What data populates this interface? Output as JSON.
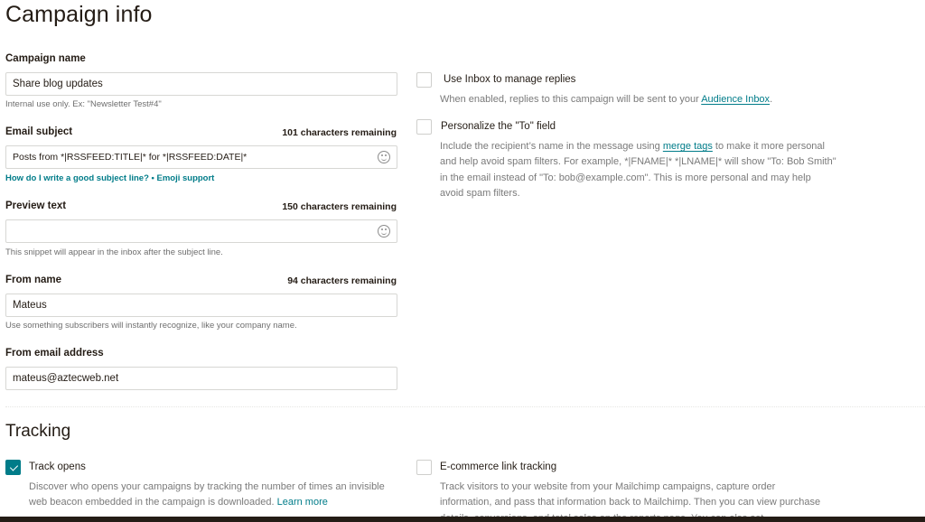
{
  "campaign_info": {
    "title": "Campaign info",
    "campaign_name": {
      "label": "Campaign name",
      "value": "Share blog updates",
      "help": "Internal use only. Ex: \"Newsletter Test#4\""
    },
    "email_subject": {
      "label": "Email subject",
      "remaining": "101 characters remaining",
      "value": "Posts from *|RSSFEED:TITLE|* for *|RSSFEED:DATE|*",
      "link_subject_help": "How do I write a good subject line?",
      "separator": "•",
      "link_emoji": "Emoji support",
      "icon": "emoji-smiley-icon"
    },
    "preview_text": {
      "label": "Preview text",
      "remaining": "150 characters remaining",
      "value": "",
      "help": "This snippet will appear in the inbox after the subject line.",
      "icon": "emoji-smiley-icon"
    },
    "from_name": {
      "label": "From name",
      "remaining": "94 characters remaining",
      "value": "Mateus",
      "help": "Use something subscribers will instantly recognize, like your company name."
    },
    "from_email": {
      "label": "From email address",
      "value": "mateus@aztecweb.net"
    },
    "options": {
      "inbox": {
        "label": "Use Inbox to manage replies",
        "checked": false,
        "desc_before": "When enabled, replies to this campaign will be sent to your ",
        "desc_link": "Audience Inbox",
        "desc_after": "."
      },
      "personalize": {
        "label": "Personalize the \"To\" field",
        "checked": false,
        "desc_before": "Include the recipient’s name in the message using ",
        "desc_link": "merge tags",
        "desc_after": " to make it more personal and help avoid spam filters. For example, *|FNAME|* *|LNAME|* will show \"To: Bob Smith\" in the email instead of \"To: bob@example.com\". This is more personal and may help avoid spam filters."
      }
    }
  },
  "tracking": {
    "title": "Tracking",
    "track_opens": {
      "label": "Track opens",
      "checked": true,
      "desc": "Discover who opens your campaigns by tracking the number of times an invisible web beacon embedded in the campaign is downloaded. ",
      "desc_link": "Learn more"
    },
    "ecommerce": {
      "label": "E-commerce link tracking",
      "checked": false,
      "desc": "Track visitors to your website from your Mailchimp campaigns, capture order information, and pass that information back to Mailchimp. Then you can view purchase details, conversions, and total sales on the reports page. You can also set"
    }
  },
  "colors": {
    "accent": "#007c89",
    "text": "#241c15",
    "muted": "#7a7a7a",
    "border": "#d7d7d4"
  }
}
